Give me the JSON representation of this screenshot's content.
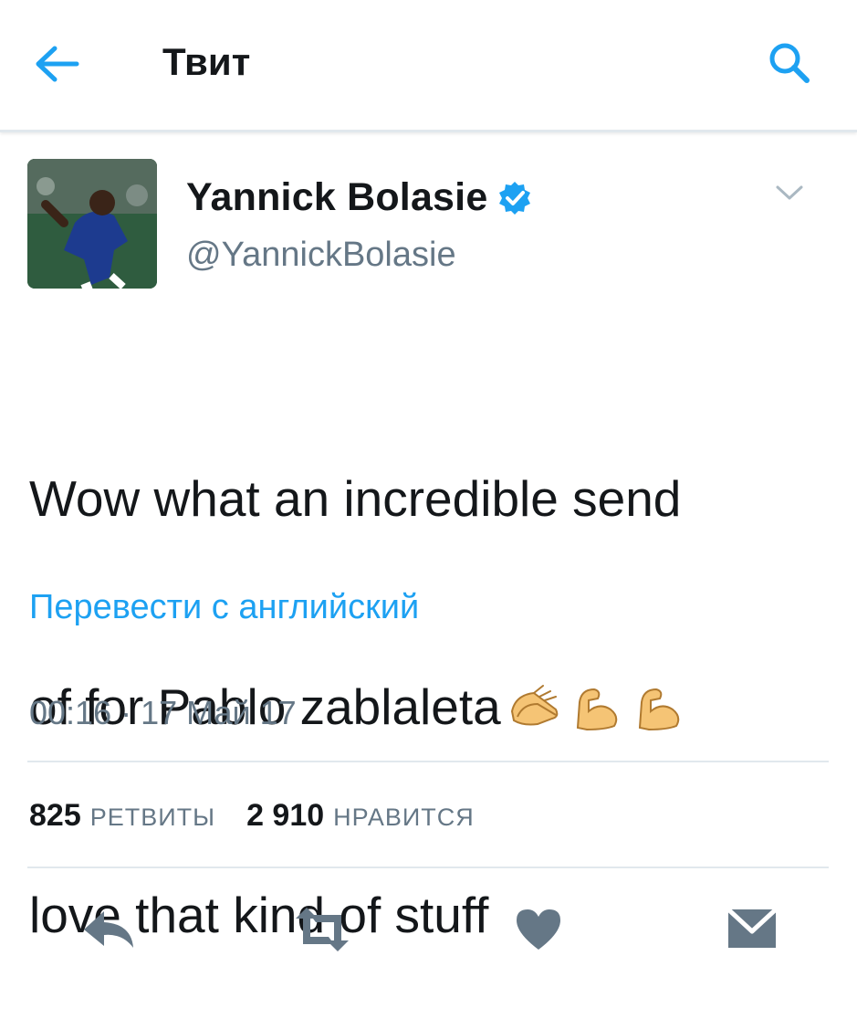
{
  "header": {
    "title": "Твит",
    "back_icon": "arrow-left-icon",
    "search_icon": "search-icon",
    "accent_color": "#1da1f2"
  },
  "tweet": {
    "author_name": "Yannick Bolasie",
    "author_handle": "@YannickBolasie",
    "verified_icon": "verified-badge-icon",
    "menu_icon": "chevron-down-icon",
    "text_line1": "Wow what an incredible send",
    "text_line2": "of for Pablo zablaleta",
    "text_line3": "love that kind of stuff",
    "emojis": [
      "clapping-hands-icon",
      "flexed-biceps-icon",
      "flexed-biceps-icon"
    ],
    "translate_link": "Перевести с английский",
    "timestamp": "00:16 · 17 Май 17"
  },
  "stats": {
    "retweets_count": "825",
    "retweets_label": "РЕТВИТЫ",
    "likes_count": "2 910",
    "likes_label": "НРАВИТСЯ"
  },
  "actions": {
    "icons": [
      "reply-icon",
      "retweet-icon",
      "like-icon",
      "direct-message-icon"
    ],
    "icon_color": "#657786"
  }
}
